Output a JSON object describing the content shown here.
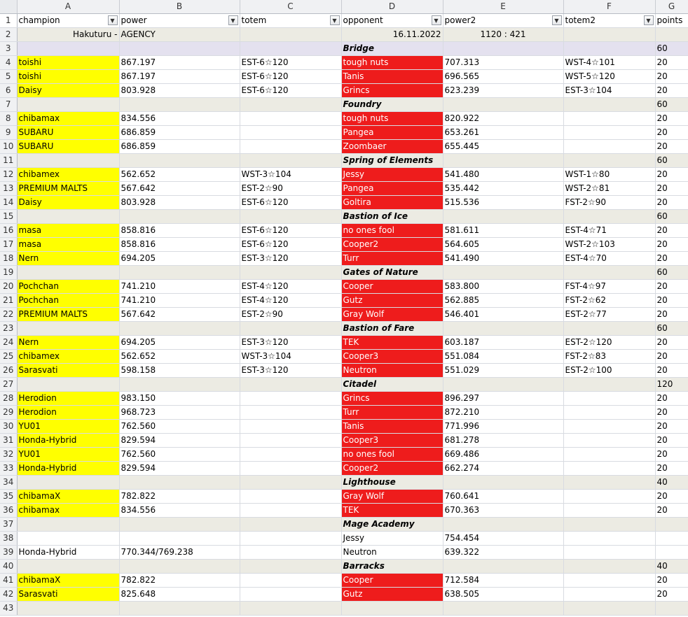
{
  "columns": [
    "A",
    "B",
    "C",
    "D",
    "E",
    "F",
    "G"
  ],
  "headers": [
    "champion",
    "power",
    "totem",
    "opponent",
    "power2",
    "totem2",
    "points"
  ],
  "info_row": {
    "a": "Hakuturu -",
    "b": "AGENCY",
    "d": "16.11.2022",
    "e": "1120 : 421"
  },
  "rows": [
    {
      "n": "3",
      "type": "loc",
      "loc": "Bridge",
      "points": "60",
      "theme": "bridge"
    },
    {
      "n": "4",
      "type": "match",
      "champion": "toishi",
      "power": "867.197",
      "totem": "EST-6☆120",
      "opponent": "tough nuts",
      "power2": "707.313",
      "totem2": "WST-4☆101",
      "points": "20"
    },
    {
      "n": "5",
      "type": "match",
      "champion": "toishi",
      "power": "867.197",
      "totem": "EST-6☆120",
      "opponent": "Tanis",
      "power2": "696.565",
      "totem2": "WST-5☆120",
      "points": "20"
    },
    {
      "n": "6",
      "type": "match",
      "champion": "Daisy",
      "power": "803.928",
      "totem": "EST-6☆120",
      "opponent": "Grincs",
      "power2": "623.239",
      "totem2": "EST-3☆104",
      "points": "20"
    },
    {
      "n": "7",
      "type": "loc",
      "loc": "Foundry",
      "points": "60"
    },
    {
      "n": "8",
      "type": "match",
      "champion": "chibamax",
      "power": "834.556",
      "totem": "",
      "opponent": "tough nuts",
      "power2": "820.922",
      "totem2": "",
      "points": "20"
    },
    {
      "n": "9",
      "type": "match",
      "champion": "SUBARU",
      "power": "686.859",
      "totem": "",
      "opponent": "Pangea",
      "power2": "653.261",
      "totem2": "",
      "points": "20"
    },
    {
      "n": "10",
      "type": "match",
      "champion": "SUBARU",
      "power": "686.859",
      "totem": "",
      "opponent": "Zoombaer",
      "power2": "655.445",
      "totem2": "",
      "points": "20"
    },
    {
      "n": "11",
      "type": "loc",
      "loc": "Spring of Elements",
      "points": "60"
    },
    {
      "n": "12",
      "type": "match",
      "champion": "chibamex",
      "power": "562.652",
      "totem": "WST-3☆104",
      "opponent": "Jessy",
      "power2": "541.480",
      "totem2": "WST-1☆80",
      "points": "20"
    },
    {
      "n": "13",
      "type": "match",
      "champion": "PREMIUM MALTS",
      "power": "567.642",
      "totem": "EST-2☆90",
      "opponent": "Pangea",
      "power2": "535.442",
      "totem2": "WST-2☆81",
      "points": "20"
    },
    {
      "n": "14",
      "type": "match",
      "champion": "Daisy",
      "power": "803.928",
      "totem": "EST-6☆120",
      "opponent": "Goltira",
      "power2": "515.536",
      "totem2": "FST-2☆90",
      "points": "20"
    },
    {
      "n": "15",
      "type": "loc",
      "loc": "Bastion of Ice",
      "points": "60"
    },
    {
      "n": "16",
      "type": "match",
      "champion": "masa",
      "power": "858.816",
      "totem": "EST-6☆120",
      "opponent": "no ones fool",
      "power2": "581.611",
      "totem2": "EST-4☆71",
      "points": "20"
    },
    {
      "n": "17",
      "type": "match",
      "champion": "masa",
      "power": "858.816",
      "totem": "EST-6☆120",
      "opponent": "Cooper2",
      "power2": "564.605",
      "totem2": "WST-2☆103",
      "points": "20"
    },
    {
      "n": "18",
      "type": "match",
      "champion": "Nern",
      "power": "694.205",
      "totem": "EST-3☆120",
      "opponent": "Turr",
      "power2": "541.490",
      "totem2": "EST-4☆70",
      "points": "20"
    },
    {
      "n": "19",
      "type": "loc",
      "loc": "Gates of Nature",
      "points": "60"
    },
    {
      "n": "20",
      "type": "match",
      "champion": "Pochchan",
      "power": "741.210",
      "totem": "EST-4☆120",
      "opponent": "Cooper",
      "power2": "583.800",
      "totem2": "FST-4☆97",
      "points": "20"
    },
    {
      "n": "21",
      "type": "match",
      "champion": "Pochchan",
      "power": "741.210",
      "totem": "EST-4☆120",
      "opponent": "Gutz",
      "power2": "562.885",
      "totem2": "FST-2☆62",
      "points": "20"
    },
    {
      "n": "22",
      "type": "match",
      "champion": "PREMIUM MALTS",
      "power": "567.642",
      "totem": "EST-2☆90",
      "opponent": "Gray Wolf",
      "power2": "546.401",
      "totem2": "EST-2☆77",
      "points": "20"
    },
    {
      "n": "23",
      "type": "loc",
      "loc": "Bastion of Fare",
      "points": "60"
    },
    {
      "n": "24",
      "type": "match",
      "champion": "Nern",
      "power": "694.205",
      "totem": "EST-3☆120",
      "opponent": "TEK",
      "power2": "603.187",
      "totem2": "EST-2☆120",
      "points": "20"
    },
    {
      "n": "25",
      "type": "match",
      "champion": "chibamex",
      "power": "562.652",
      "totem": "WST-3☆104",
      "opponent": "Cooper3",
      "power2": "551.084",
      "totem2": "FST-2☆83",
      "points": "20"
    },
    {
      "n": "26",
      "type": "match",
      "champion": "Sarasvati",
      "power": "598.158",
      "totem": "EST-3☆120",
      "opponent": "Neutron",
      "power2": "551.029",
      "totem2": "EST-2☆100",
      "points": "20"
    },
    {
      "n": "27",
      "type": "loc",
      "loc": "Citadel",
      "points": "120"
    },
    {
      "n": "28",
      "type": "match",
      "champion": "Herodion",
      "power": "983.150",
      "totem": "",
      "opponent": "Grincs",
      "power2": "896.297",
      "totem2": "",
      "points": "20"
    },
    {
      "n": "29",
      "type": "match",
      "champion": "Herodion",
      "power": "968.723",
      "totem": "",
      "opponent": "Turr",
      "power2": "872.210",
      "totem2": "",
      "points": "20"
    },
    {
      "n": "30",
      "type": "match",
      "champion": "YU01",
      "power": "762.560",
      "totem": "",
      "opponent": "Tanis",
      "power2": "771.996",
      "totem2": "",
      "points": "20"
    },
    {
      "n": "31",
      "type": "match",
      "champion": "Honda-Hybrid",
      "power": "829.594",
      "totem": "",
      "opponent": "Cooper3",
      "power2": "681.278",
      "totem2": "",
      "points": "20"
    },
    {
      "n": "32",
      "type": "match",
      "champion": "YU01",
      "power": "762.560",
      "totem": "",
      "opponent": "no ones fool",
      "power2": "669.486",
      "totem2": "",
      "points": "20"
    },
    {
      "n": "33",
      "type": "match",
      "champion": "Honda-Hybrid",
      "power": "829.594",
      "totem": "",
      "opponent": "Cooper2",
      "power2": "662.274",
      "totem2": "",
      "points": "20"
    },
    {
      "n": "34",
      "type": "loc",
      "loc": "Lighthouse",
      "points": "40"
    },
    {
      "n": "35",
      "type": "match",
      "champion": "chibamaX",
      "power": "782.822",
      "totem": "",
      "opponent": "Gray Wolf",
      "power2": "760.641",
      "totem2": "",
      "points": "20"
    },
    {
      "n": "36",
      "type": "match",
      "champion": "chibamax",
      "power": "834.556",
      "totem": "",
      "opponent": "TEK",
      "power2": "670.363",
      "totem2": "",
      "points": "20"
    },
    {
      "n": "37",
      "type": "loc",
      "loc": "Mage Academy",
      "points": ""
    },
    {
      "n": "38",
      "type": "plain",
      "champion": "",
      "power": "",
      "totem": "",
      "opponent": "Jessy",
      "power2": "754.454",
      "totem2": "",
      "points": ""
    },
    {
      "n": "39",
      "type": "plain",
      "champion": "Honda-Hybrid",
      "power": "770.344/769.238",
      "totem": "",
      "opponent": "Neutron",
      "power2": "639.322",
      "totem2": "",
      "points": ""
    },
    {
      "n": "40",
      "type": "loc",
      "loc": "Barracks",
      "points": "40"
    },
    {
      "n": "41",
      "type": "match",
      "champion": "chibamaX",
      "power": "782.822",
      "totem": "",
      "opponent": "Cooper",
      "power2": "712.584",
      "totem2": "",
      "points": "20"
    },
    {
      "n": "42",
      "type": "match",
      "champion": "Sarasvati",
      "power": "825.648",
      "totem": "",
      "opponent": "Gutz",
      "power2": "638.505",
      "totem2": "",
      "points": "20"
    },
    {
      "n": "43",
      "type": "loc",
      "loc": "",
      "points": ""
    }
  ]
}
